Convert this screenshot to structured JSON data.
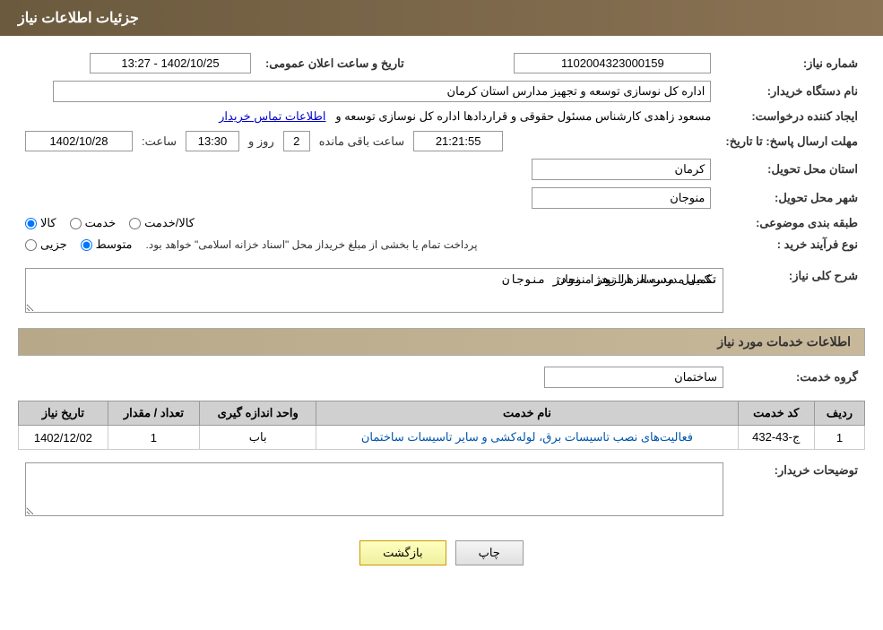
{
  "header": {
    "title": "جزئیات اطلاعات نیاز"
  },
  "fields": {
    "tender_number_label": "شماره نیاز:",
    "tender_number_value": "1102004323000159",
    "publish_date_label": "تاریخ و ساعت اعلان عمومی:",
    "publish_date_value": "1402/10/25 - 13:27",
    "buyer_org_label": "نام دستگاه خریدار:",
    "buyer_org_value": "اداره کل نوسازی  توسعه و تجهیز مدارس استان کرمان",
    "creator_label": "ایجاد کننده درخواست:",
    "creator_value": "مسعود زاهدی کارشناس مسئول حقوقی و قراردادها اداره کل نوسازی  توسعه و",
    "contact_link": "اطلاعات تماس خریدار",
    "reply_deadline_label": "مهلت ارسال پاسخ: تا تاریخ:",
    "reply_date": "1402/10/28",
    "reply_time_label": "ساعت:",
    "reply_time": "13:30",
    "reply_days_label": "روز و",
    "reply_days": "2",
    "reply_remaining_label": "ساعت باقی مانده",
    "reply_remaining_time": "21:21:55",
    "province_label": "استان محل تحویل:",
    "province_value": "کرمان",
    "city_label": "شهر محل تحویل:",
    "city_value": "منوجان",
    "category_label": "طبقه بندی موضوعی:",
    "category_options": [
      "کالا",
      "خدمت",
      "کالا/خدمت"
    ],
    "category_selected": "کالا",
    "purchase_type_label": "نوع فرآیند خرید :",
    "purchase_type_options": [
      "جزیی",
      "متوسط"
    ],
    "purchase_type_note": "پرداخت تمام یا بخشی از مبلغ خریداز محل \"اسناد خزانه اسلامی\" خواهد بود.",
    "purchase_type_selected": "متوسط",
    "description_label": "شرح کلی نیاز:",
    "description_value": "تکمیل مدرسه الزهرا نودژ منوجان"
  },
  "services_section": {
    "title": "اطلاعات خدمات مورد نیاز",
    "service_group_label": "گروه خدمت:",
    "service_group_value": "ساختمان",
    "table_headers": [
      "ردیف",
      "کد خدمت",
      "نام خدمت",
      "واحد اندازه گیری",
      "تعداد / مقدار",
      "تاریخ نیاز"
    ],
    "rows": [
      {
        "row_num": "1",
        "service_code": "ج-43-432",
        "service_name": "فعالیت‌های نصب تاسیسات برق، لوله‌کشی و سایر تاسیسات ساختمان",
        "unit": "باب",
        "quantity": "1",
        "date": "1402/12/02"
      }
    ]
  },
  "buyer_notes_label": "توضیحات خریدار:",
  "buyer_notes_value": "",
  "buttons": {
    "print_label": "چاپ",
    "back_label": "بازگشت"
  }
}
